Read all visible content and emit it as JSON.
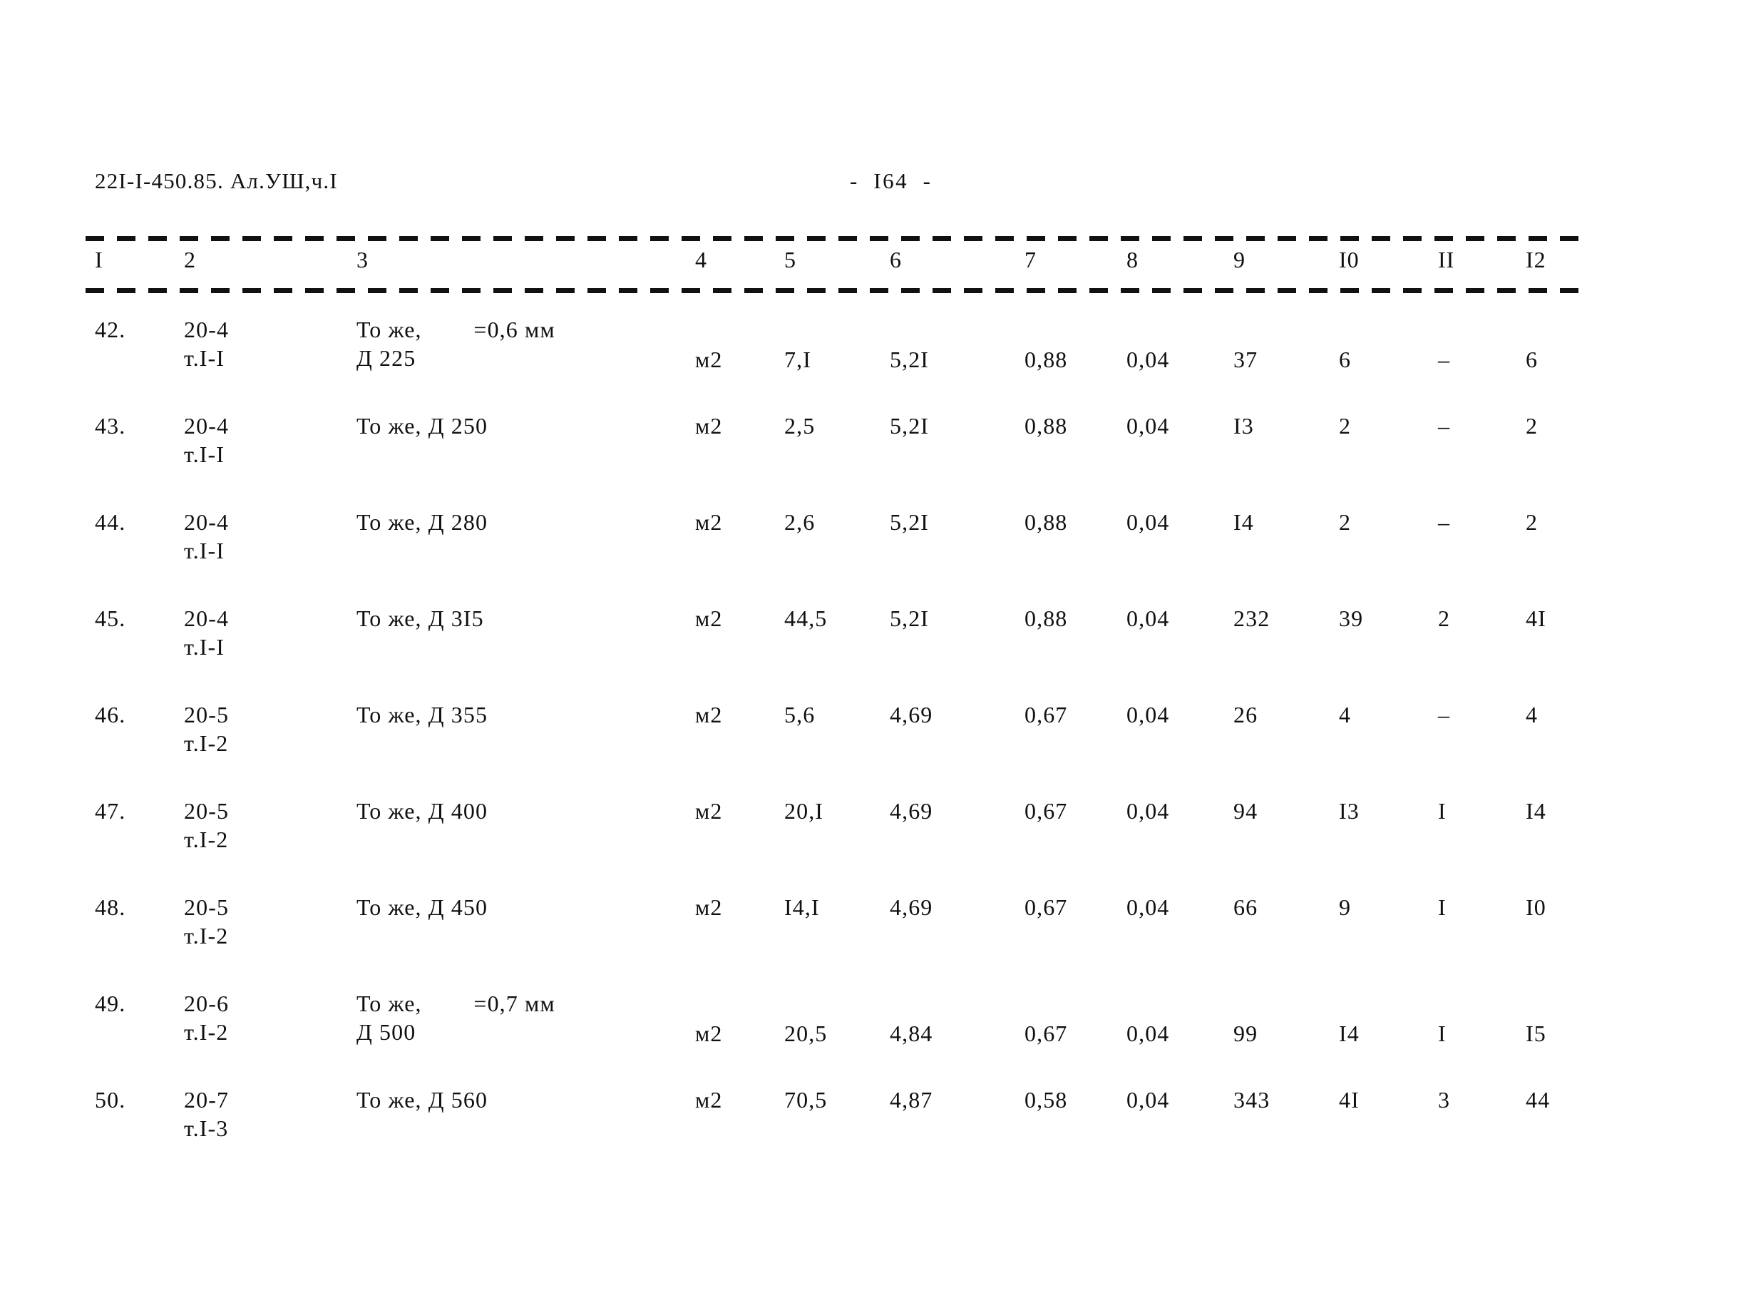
{
  "document": {
    "code": "22I-I-450.85. Ал.УШ,ч.I",
    "page_label": "-  I64  -"
  },
  "table": {
    "column_numbers": [
      "I",
      "2",
      "3",
      "4",
      "5",
      "6",
      "7",
      "8",
      "9",
      "I0",
      "II",
      "I2"
    ],
    "rows": [
      {
        "no": "42.",
        "code_line1": "20-4",
        "code_line2": "т.I-I",
        "desc_line1": "То же,        =0,6 мм",
        "desc_line2": "Д 225",
        "unit": "м2",
        "c5": "7,I",
        "c6": "5,2I",
        "c7": "0,88",
        "c8": "0,04",
        "c9": "37",
        "c10": "6",
        "c11": "–",
        "c12": "6"
      },
      {
        "no": "43.",
        "code_line1": "20-4",
        "code_line2": "т.I-I",
        "desc_line1": "То же, Д 250",
        "desc_line2": "",
        "unit": "м2",
        "c5": "2,5",
        "c6": "5,2I",
        "c7": "0,88",
        "c8": "0,04",
        "c9": "I3",
        "c10": "2",
        "c11": "–",
        "c12": "2"
      },
      {
        "no": "44.",
        "code_line1": "20-4",
        "code_line2": "т.I-I",
        "desc_line1": "То же, Д 280",
        "desc_line2": "",
        "unit": "м2",
        "c5": "2,6",
        "c6": "5,2I",
        "c7": "0,88",
        "c8": "0,04",
        "c9": "I4",
        "c10": "2",
        "c11": "–",
        "c12": "2"
      },
      {
        "no": "45.",
        "code_line1": "20-4",
        "code_line2": "т.I-I",
        "desc_line1": "То же, Д 3I5",
        "desc_line2": "",
        "unit": "м2",
        "c5": "44,5",
        "c6": "5,2I",
        "c7": "0,88",
        "c8": "0,04",
        "c9": "232",
        "c10": "39",
        "c11": "2",
        "c12": "4I"
      },
      {
        "no": "46.",
        "code_line1": "20-5",
        "code_line2": "т.I-2",
        "desc_line1": "То же, Д 355",
        "desc_line2": "",
        "unit": "м2",
        "c5": "5,6",
        "c6": "4,69",
        "c7": "0,67",
        "c8": "0,04",
        "c9": "26",
        "c10": "4",
        "c11": "–",
        "c12": "4"
      },
      {
        "no": "47.",
        "code_line1": "20-5",
        "code_line2": "т.I-2",
        "desc_line1": "То же, Д 400",
        "desc_line2": "",
        "unit": "м2",
        "c5": "20,I",
        "c6": "4,69",
        "c7": "0,67",
        "c8": "0,04",
        "c9": "94",
        "c10": "I3",
        "c11": "I",
        "c12": "I4"
      },
      {
        "no": "48.",
        "code_line1": "20-5",
        "code_line2": "т.I-2",
        "desc_line1": "То же, Д 450",
        "desc_line2": "",
        "unit": "м2",
        "c5": "I4,I",
        "c6": "4,69",
        "c7": "0,67",
        "c8": "0,04",
        "c9": "66",
        "c10": "9",
        "c11": "I",
        "c12": "I0"
      },
      {
        "no": "49.",
        "code_line1": "20-6",
        "code_line2": "т.I-2",
        "desc_line1": "То же,        =0,7 мм",
        "desc_line2": "Д 500",
        "unit": "м2",
        "c5": "20,5",
        "c6": "4,84",
        "c7": "0,67",
        "c8": "0,04",
        "c9": "99",
        "c10": "I4",
        "c11": "I",
        "c12": "I5"
      },
      {
        "no": "50.",
        "code_line1": "20-7",
        "code_line2": "т.I-3",
        "desc_line1": "То же, Д 560",
        "desc_line2": "",
        "unit": "м2",
        "c5": "70,5",
        "c6": "4,87",
        "c7": "0,58",
        "c8": "0,04",
        "c9": "343",
        "c10": "4I",
        "c11": "3",
        "c12": "44"
      }
    ]
  }
}
